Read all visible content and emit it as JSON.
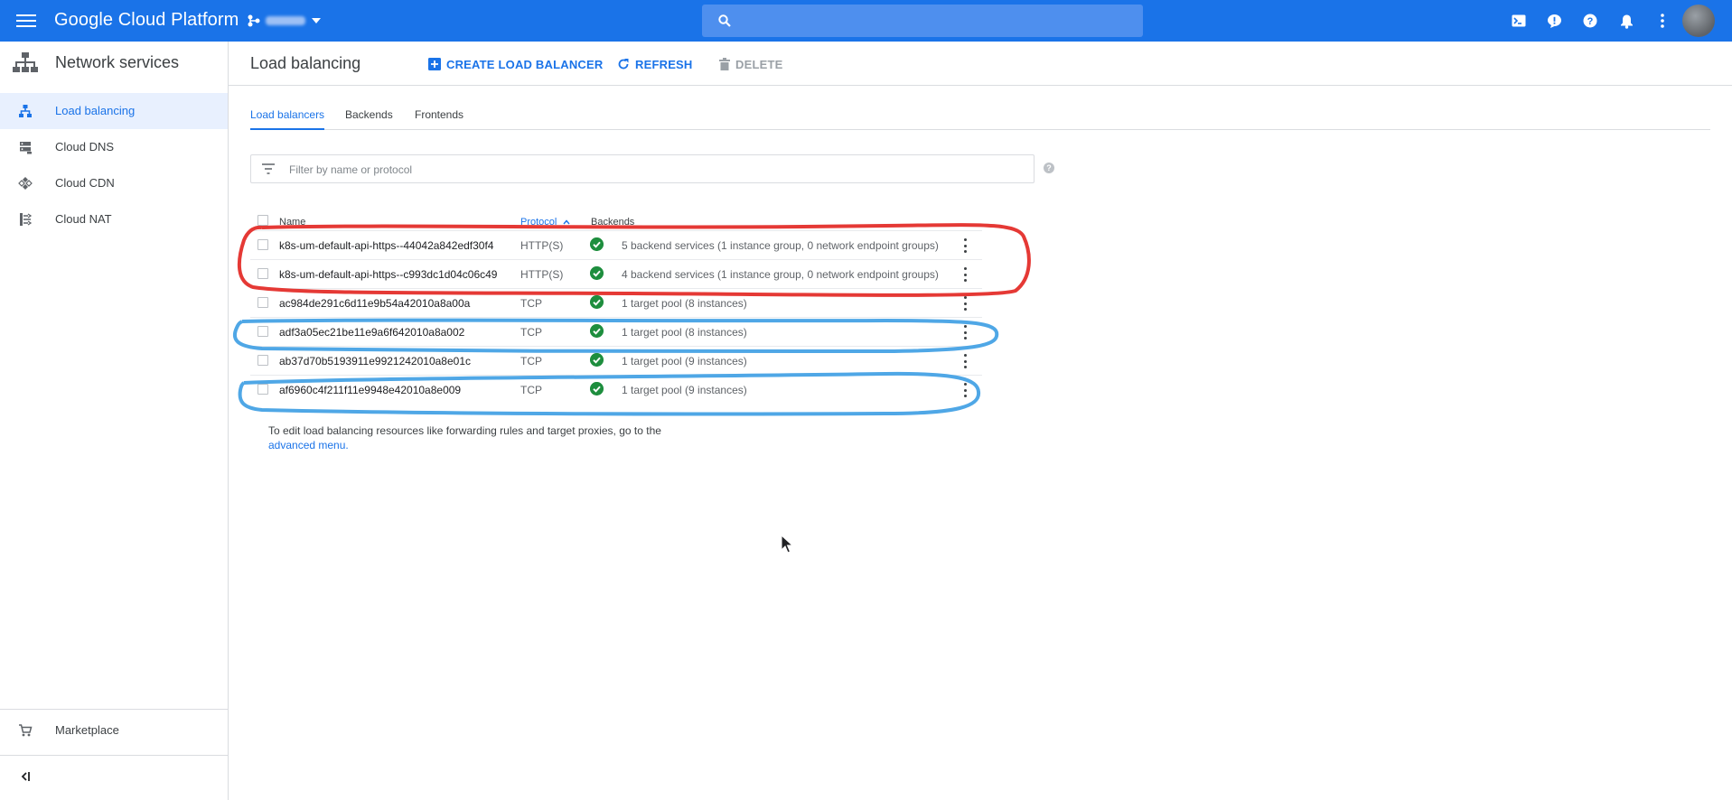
{
  "topbar": {
    "brand": "Google Cloud Platform",
    "search_placeholder": ""
  },
  "sidebar": {
    "title": "Network services",
    "items": [
      {
        "label": "Load balancing"
      },
      {
        "label": "Cloud DNS"
      },
      {
        "label": "Cloud CDN"
      },
      {
        "label": "Cloud NAT"
      }
    ],
    "marketplace": "Marketplace",
    "collapse": "<|"
  },
  "header": {
    "title": "Load balancing",
    "create": "CREATE LOAD BALANCER",
    "refresh": "REFRESH",
    "delete": "DELETE"
  },
  "tabs": [
    "Load balancers",
    "Backends",
    "Frontends"
  ],
  "filter": {
    "placeholder": "Filter by name or protocol",
    "help": "?"
  },
  "table": {
    "columns": {
      "name": "Name",
      "protocol": "Protocol",
      "backends": "Backends"
    },
    "rows": [
      {
        "name": "k8s-um-default-api-https--44042a842edf30f4",
        "protocol": "HTTP(S)",
        "backends": "5 backend services (1 instance group, 0 network endpoint groups)"
      },
      {
        "name": "k8s-um-default-api-https--c993dc1d04c06c49",
        "protocol": "HTTP(S)",
        "backends": "4 backend services (1 instance group, 0 network endpoint groups)"
      },
      {
        "name": "ac984de291c6d11e9b54a42010a8a00a",
        "protocol": "TCP",
        "backends": "1 target pool (8 instances)"
      },
      {
        "name": "adf3a05ec21be11e9a6f642010a8a002",
        "protocol": "TCP",
        "backends": "1 target pool (8 instances)"
      },
      {
        "name": "ab37d70b5193911e9921242010a8e01c",
        "protocol": "TCP",
        "backends": "1 target pool (9 instances)"
      },
      {
        "name": "af6960c4f211f11e9948e42010a8e009",
        "protocol": "TCP",
        "backends": "1 target pool (9 instances)"
      }
    ]
  },
  "note": {
    "text": "To edit load balancing resources like forwarding rules and target proxies, go to the",
    "link": "advanced menu."
  },
  "colors": {
    "primary": "#1a73e8",
    "status_ok": "#1e8e3e",
    "annotation_red": "#e53935",
    "annotation_blue": "#4fa7e6"
  }
}
